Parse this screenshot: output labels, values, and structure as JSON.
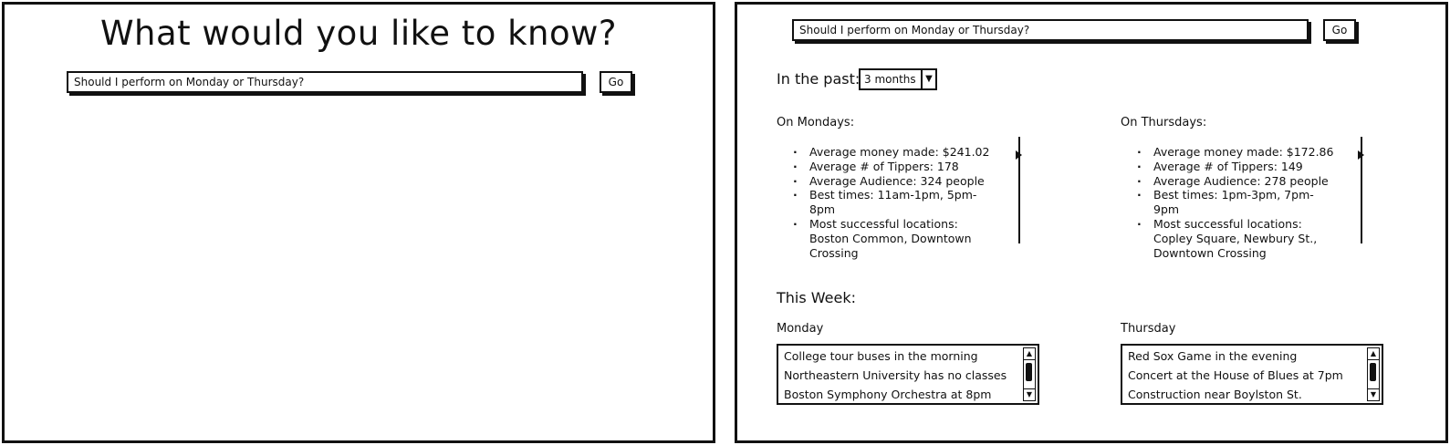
{
  "left": {
    "title": "What would you like to know?",
    "search_value": "Should I perform on Monday or Thursday?",
    "go_label": "Go"
  },
  "right": {
    "search_value": "Should I perform on Monday or Thursday?",
    "go_label": "Go",
    "past_label": "In the past:",
    "range_value": "3 months",
    "mondays": {
      "heading": "On Mondays:",
      "stats": [
        "Average money made: $241.02",
        "Average # of Tippers: 178",
        "Average Audience: 324 people",
        "Best times: 11am-1pm, 5pm-8pm",
        "Most successful locations: Boston Common, Downtown Crossing"
      ]
    },
    "thursdays": {
      "heading": "On Thursdays:",
      "stats": [
        "Average money made: $172.86",
        "Average # of Tippers: 149",
        "Average Audience: 278 people",
        "Best times: 1pm-3pm, 7pm-9pm",
        "Most successful locations: Copley Square, Newbury St., Downtown Crossing"
      ]
    },
    "this_week_label": "This Week:",
    "monday": {
      "heading": "Monday",
      "events": [
        "College tour buses in the morning",
        "Northeastern University has no classes",
        "Boston Symphony Orchestra at 8pm"
      ]
    },
    "thursday": {
      "heading": "Thursday",
      "events": [
        "Red Sox Game in the evening",
        "Concert at the House of Blues at 7pm",
        "Construction near Boylston St."
      ]
    }
  }
}
